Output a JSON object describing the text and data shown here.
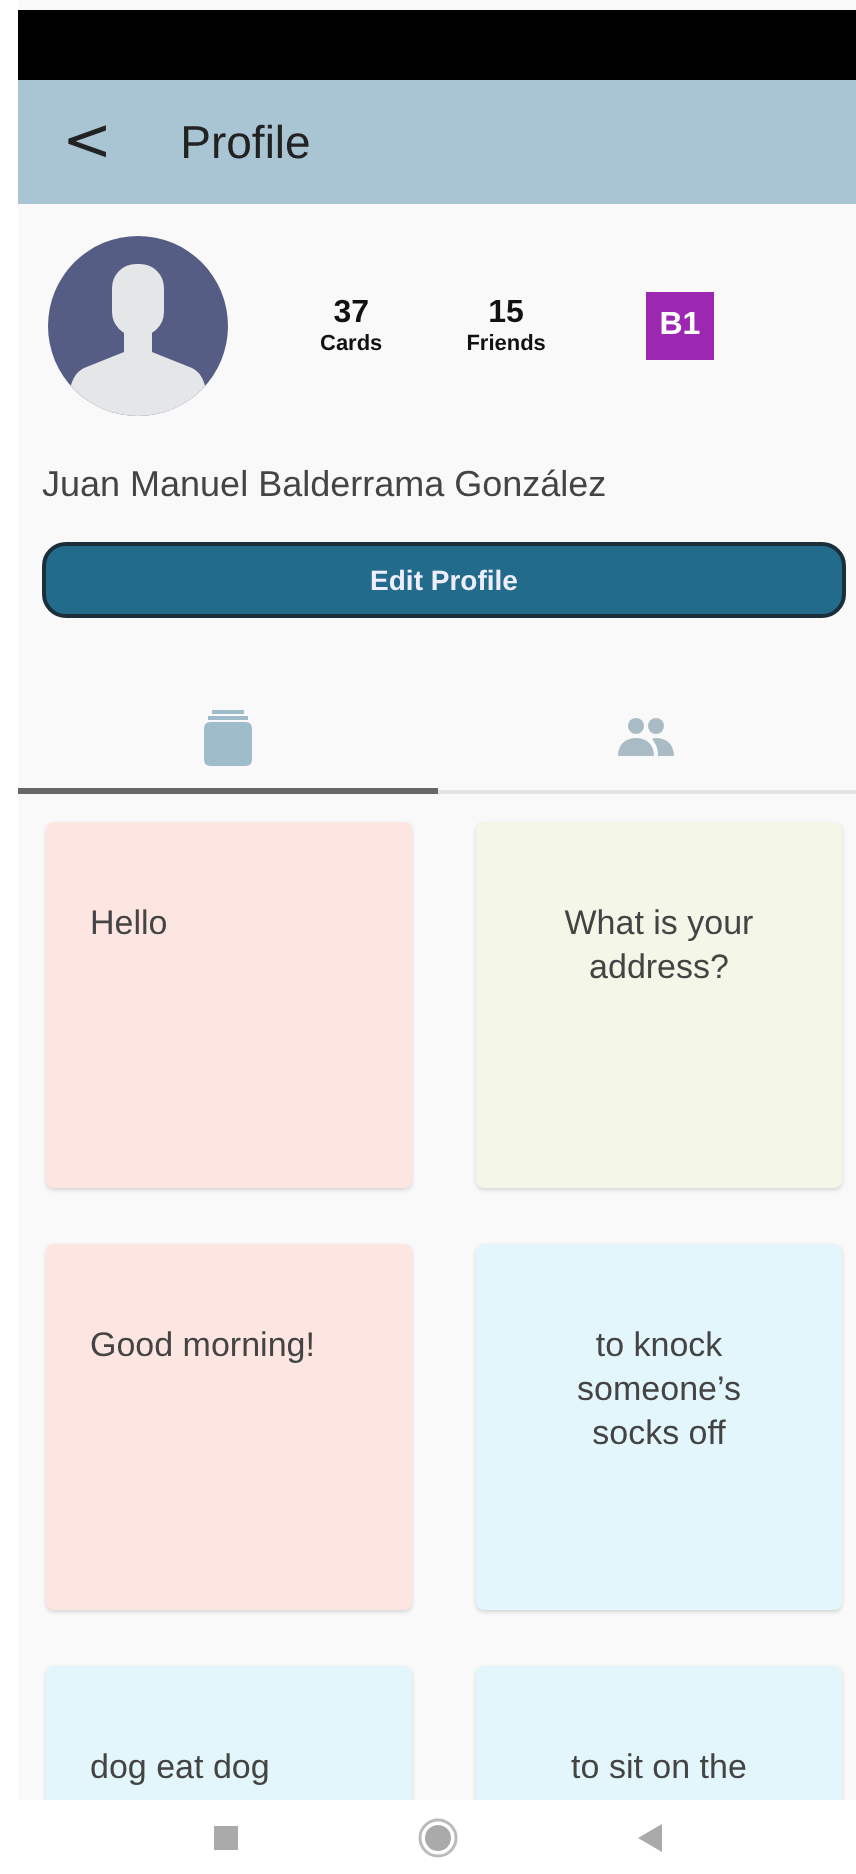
{
  "header": {
    "back": "<",
    "title": "Profile"
  },
  "profile": {
    "stats": [
      {
        "value": "37",
        "label": "Cards"
      },
      {
        "value": "15",
        "label": "Friends"
      }
    ],
    "level_badge": "B1",
    "name": "Juan Manuel Balderrama González",
    "edit_button": "Edit Profile"
  },
  "tabs": [
    {
      "kind": "cards",
      "selected": true
    },
    {
      "kind": "friends",
      "selected": false
    }
  ],
  "cards": [
    {
      "text": "Hello",
      "color": "#fde6e1",
      "kind": "plain"
    },
    {
      "text": "What is your address?",
      "color": "#f4f7e8",
      "kind": "centered"
    },
    {
      "text": "Good morning!",
      "color": "#fde6e1",
      "kind": "plain"
    },
    {
      "text": "to knock someone’s socks off",
      "color": "#e3f6fb",
      "kind": "centered"
    },
    {
      "text": "dog eat dog",
      "color": "#e3f6fb",
      "kind": "plain"
    },
    {
      "text": "to sit on the",
      "color": "#e3f6fb",
      "kind": "centered"
    }
  ]
}
